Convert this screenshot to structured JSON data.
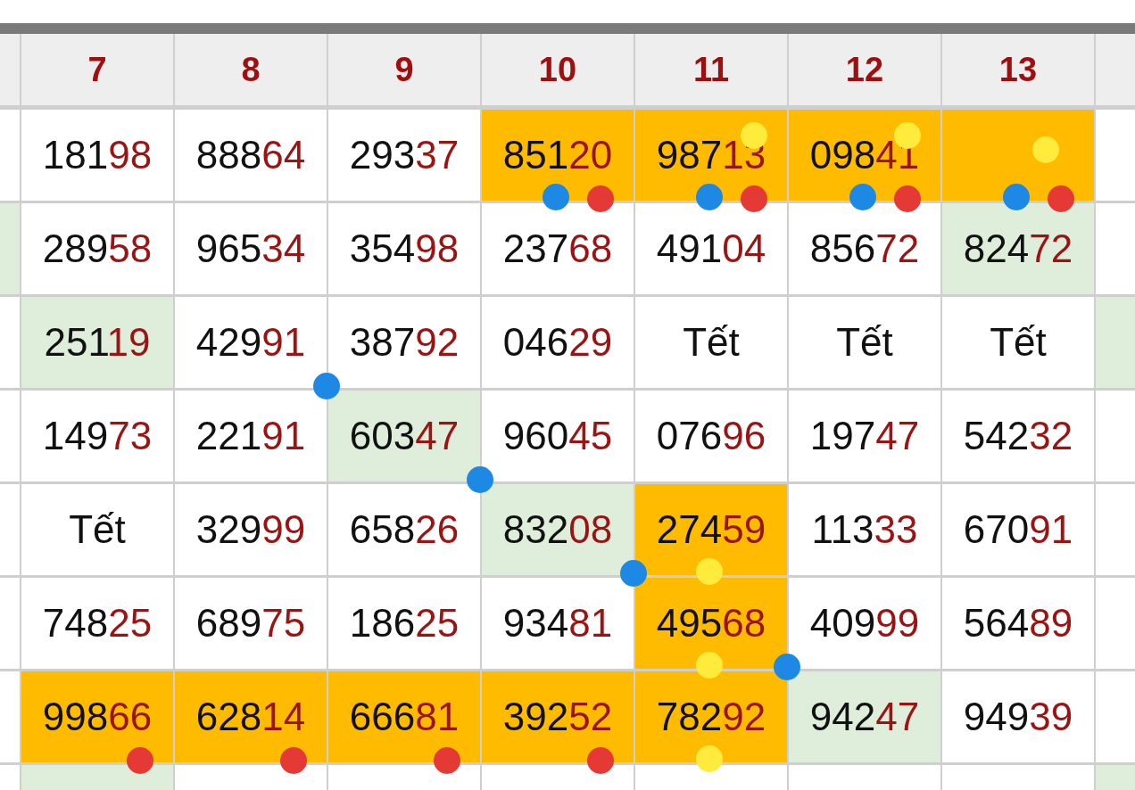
{
  "header": {
    "columns": [
      "7",
      "8",
      "9",
      "10",
      "11",
      "12",
      "13"
    ]
  },
  "rows": [
    {
      "cells": [
        {
          "kind": "cut",
          "color": "#ffffff"
        },
        {
          "kind": "number",
          "lead": "181",
          "tail": "98",
          "color": "#ffffff"
        },
        {
          "kind": "number",
          "lead": "888",
          "tail": "64",
          "color": "#ffffff"
        },
        {
          "kind": "number",
          "lead": "293",
          "tail": "37",
          "color": "#ffffff"
        },
        {
          "kind": "number",
          "lead": "851",
          "tail": "20",
          "color": "#ffbb00",
          "dots": [
            {
              "color": "#1e88e5",
              "kind": "bottom"
            },
            {
              "color": "#e53935",
              "kind": "offset"
            }
          ]
        },
        {
          "kind": "number",
          "lead": "987",
          "tail": "13",
          "color": "#ffbb00",
          "dots": [
            {
              "color": "#ffeb3b",
              "kind": "top"
            },
            {
              "color": "#1e88e5",
              "kind": "bottom"
            },
            {
              "color": "#e53935",
              "kind": "offset"
            }
          ]
        },
        {
          "kind": "number",
          "lead": "098",
          "tail": "41",
          "color": "#ffbb00",
          "dots": [
            {
              "color": "#ffeb3b",
              "kind": "top"
            },
            {
              "color": "#1e88e5",
              "kind": "bottom"
            },
            {
              "color": "#e53935",
              "kind": "offset"
            }
          ]
        },
        {
          "kind": "empty",
          "color": "#ffbb00",
          "dots": [
            {
              "color": "#ffeb3b",
              "kind": "middle"
            },
            {
              "color": "#1e88e5",
              "kind": "bottom"
            },
            {
              "color": "#e53935",
              "kind": "offset"
            }
          ]
        },
        {
          "kind": "cut",
          "color": "#ffffff"
        }
      ]
    },
    {
      "cells": [
        {
          "kind": "cut",
          "color": "#dfeedb"
        },
        {
          "kind": "number",
          "lead": "289",
          "tail": "58",
          "color": "#ffffff"
        },
        {
          "kind": "number",
          "lead": "965",
          "tail": "34",
          "color": "#ffffff"
        },
        {
          "kind": "number",
          "lead": "354",
          "tail": "98",
          "color": "#ffffff"
        },
        {
          "kind": "number",
          "lead": "237",
          "tail": "68",
          "color": "#ffffff"
        },
        {
          "kind": "number",
          "lead": "491",
          "tail": "04",
          "color": "#ffffff"
        },
        {
          "kind": "number",
          "lead": "856",
          "tail": "72",
          "color": "#ffffff"
        },
        {
          "kind": "number",
          "lead": "824",
          "tail": "72",
          "color": "#dfeedb"
        },
        {
          "kind": "cut",
          "color": "#ffffff"
        }
      ]
    },
    {
      "cells": [
        {
          "kind": "cut",
          "color": "#ffffff"
        },
        {
          "kind": "number",
          "lead": "251",
          "tail": "19",
          "color": "#dfeedb"
        },
        {
          "kind": "number",
          "lead": "429",
          "tail": "91",
          "color": "#ffffff",
          "dots": [
            {
              "color": "#1e88e5",
              "kind": "corner"
            }
          ]
        },
        {
          "kind": "number",
          "lead": "387",
          "tail": "92",
          "color": "#ffffff"
        },
        {
          "kind": "number",
          "lead": "046",
          "tail": "29",
          "color": "#ffffff"
        },
        {
          "kind": "holiday",
          "text": "Tết",
          "color": "#ffffff"
        },
        {
          "kind": "holiday",
          "text": "Tết",
          "color": "#ffffff"
        },
        {
          "kind": "holiday",
          "text": "Tết",
          "color": "#ffffff"
        },
        {
          "kind": "cut",
          "color": "#dfeedb"
        }
      ]
    },
    {
      "cells": [
        {
          "kind": "cut",
          "color": "#ffffff"
        },
        {
          "kind": "number",
          "lead": "149",
          "tail": "73",
          "color": "#ffffff"
        },
        {
          "kind": "number",
          "lead": "221",
          "tail": "91",
          "color": "#ffffff"
        },
        {
          "kind": "number",
          "lead": "603",
          "tail": "47",
          "color": "#dfeedb",
          "dots": [
            {
              "color": "#1e88e5",
              "kind": "corner"
            }
          ]
        },
        {
          "kind": "number",
          "lead": "960",
          "tail": "45",
          "color": "#ffffff"
        },
        {
          "kind": "number",
          "lead": "076",
          "tail": "96",
          "color": "#ffffff"
        },
        {
          "kind": "number",
          "lead": "197",
          "tail": "47",
          "color": "#ffffff"
        },
        {
          "kind": "number",
          "lead": "542",
          "tail": "32",
          "color": "#ffffff"
        },
        {
          "kind": "cut",
          "color": "#ffffff"
        }
      ]
    },
    {
      "cells": [
        {
          "kind": "cut",
          "color": "#ffffff"
        },
        {
          "kind": "holiday",
          "text": "Tết",
          "color": "#ffffff"
        },
        {
          "kind": "number",
          "lead": "329",
          "tail": "99",
          "color": "#ffffff"
        },
        {
          "kind": "number",
          "lead": "658",
          "tail": "26",
          "color": "#ffffff"
        },
        {
          "kind": "number",
          "lead": "832",
          "tail": "08",
          "color": "#dfeedb",
          "dots": [
            {
              "color": "#1e88e5",
              "kind": "corner"
            }
          ]
        },
        {
          "kind": "number",
          "lead": "274",
          "tail": "59",
          "color": "#ffbb00",
          "dots": [
            {
              "color": "#ffeb3b",
              "kind": "bottom"
            }
          ]
        },
        {
          "kind": "number",
          "lead": "113",
          "tail": "33",
          "color": "#ffffff"
        },
        {
          "kind": "number",
          "lead": "670",
          "tail": "91",
          "color": "#ffffff"
        },
        {
          "kind": "cut",
          "color": "#ffffff"
        }
      ]
    },
    {
      "cells": [
        {
          "kind": "cut",
          "color": "#ffffff"
        },
        {
          "kind": "number",
          "lead": "748",
          "tail": "25",
          "color": "#ffffff"
        },
        {
          "kind": "number",
          "lead": "689",
          "tail": "75",
          "color": "#ffffff"
        },
        {
          "kind": "number",
          "lead": "186",
          "tail": "25",
          "color": "#ffffff"
        },
        {
          "kind": "number",
          "lead": "934",
          "tail": "81",
          "color": "#ffffff"
        },
        {
          "kind": "number",
          "lead": "495",
          "tail": "68",
          "color": "#ffbb00",
          "dots": [
            {
              "color": "#ffeb3b",
              "kind": "bottom"
            },
            {
              "color": "#1e88e5",
              "kind": "corner"
            }
          ]
        },
        {
          "kind": "number",
          "lead": "409",
          "tail": "99",
          "color": "#ffffff"
        },
        {
          "kind": "number",
          "lead": "564",
          "tail": "89",
          "color": "#ffffff"
        },
        {
          "kind": "cut",
          "color": "#ffffff"
        }
      ]
    },
    {
      "cells": [
        {
          "kind": "cut",
          "color": "#ffffff"
        },
        {
          "kind": "number",
          "lead": "998",
          "tail": "66",
          "color": "#ffbb00",
          "dots": [
            {
              "color": "#e53935",
              "kind": "offset"
            }
          ]
        },
        {
          "kind": "number",
          "lead": "628",
          "tail": "14",
          "color": "#ffbb00",
          "dots": [
            {
              "color": "#e53935",
              "kind": "offset"
            }
          ]
        },
        {
          "kind": "number",
          "lead": "666",
          "tail": "81",
          "color": "#ffbb00",
          "dots": [
            {
              "color": "#e53935",
              "kind": "offset"
            }
          ]
        },
        {
          "kind": "number",
          "lead": "392",
          "tail": "52",
          "color": "#ffbb00",
          "dots": [
            {
              "color": "#e53935",
              "kind": "offset"
            }
          ]
        },
        {
          "kind": "number",
          "lead": "782",
          "tail": "92",
          "color": "#ffbb00",
          "dots": [
            {
              "color": "#ffeb3b",
              "kind": "bottom"
            }
          ]
        },
        {
          "kind": "number",
          "lead": "942",
          "tail": "47",
          "color": "#dfeedb"
        },
        {
          "kind": "number",
          "lead": "949",
          "tail": "39",
          "color": "#ffffff"
        },
        {
          "kind": "cut",
          "color": "#ffffff"
        }
      ]
    },
    {
      "cells": [
        {
          "kind": "cut",
          "color": "#ffffff"
        },
        {
          "kind": "empty",
          "color": "#dfeedb"
        },
        {
          "kind": "empty",
          "color": "#ffffff"
        },
        {
          "kind": "empty",
          "color": "#ffffff"
        },
        {
          "kind": "empty",
          "color": "#ffffff"
        },
        {
          "kind": "empty",
          "color": "#ffffff"
        },
        {
          "kind": "empty",
          "color": "#ffffff"
        },
        {
          "kind": "empty",
          "color": "#ffffff"
        },
        {
          "kind": "cut",
          "color": "#dfeedb"
        }
      ]
    }
  ]
}
